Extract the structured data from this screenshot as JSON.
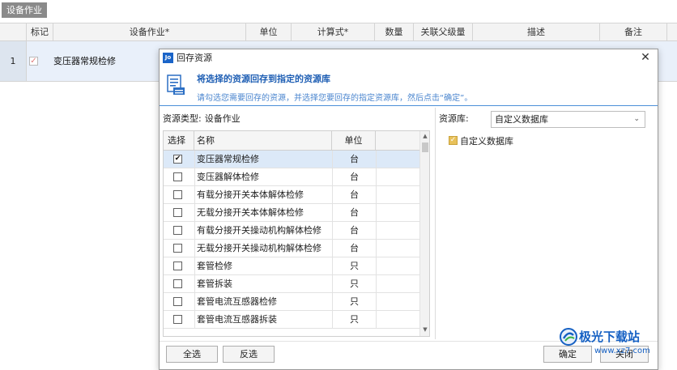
{
  "tab": {
    "label": "设备作业"
  },
  "grid": {
    "columns": [
      "标记",
      "设备作业*",
      "单位",
      "计算式*",
      "数量",
      "关联父级量",
      "描述",
      "备注"
    ],
    "row": {
      "index": "1",
      "name": "变压器常规检修",
      "checked": true
    }
  },
  "dialog": {
    "title": "回存资源",
    "app_icon": "Jo",
    "banner_title": "将选择的资源回存到指定的资源库",
    "banner_desc": "请勾选您需要回存的资源，并选择您要回存的指定资源库，然后点击“确定”。",
    "resource_type_label": "资源类型:",
    "resource_type_value": "设备作业",
    "list_headers": {
      "select": "选择",
      "name": "名称",
      "unit": "单位"
    },
    "items": [
      {
        "name": "变压器常规检修",
        "unit": "台",
        "checked": true
      },
      {
        "name": "变压器解体检修",
        "unit": "台",
        "checked": false
      },
      {
        "name": "有载分接开关本体解体检修",
        "unit": "台",
        "checked": false
      },
      {
        "name": "无载分接开关本体解体检修",
        "unit": "台",
        "checked": false
      },
      {
        "name": "有载分接开关操动机构解体检修",
        "unit": "台",
        "checked": false
      },
      {
        "name": "无载分接开关操动机构解体检修",
        "unit": "台",
        "checked": false
      },
      {
        "name": "套管检修",
        "unit": "只",
        "checked": false
      },
      {
        "name": "套管拆装",
        "unit": "只",
        "checked": false
      },
      {
        "name": "套管电流互感器检修",
        "unit": "只",
        "checked": false
      },
      {
        "name": "套管电流互感器拆装",
        "unit": "只",
        "checked": false
      }
    ],
    "library_label": "资源库:",
    "library_value": "自定义数据库",
    "library_option_label": "自定义数据库",
    "buttons": {
      "select_all": "全选",
      "invert": "反选",
      "ok": "确定",
      "close": "关闭"
    }
  },
  "watermark": {
    "text": "极光下载站",
    "sub": "www.xz7.com"
  }
}
